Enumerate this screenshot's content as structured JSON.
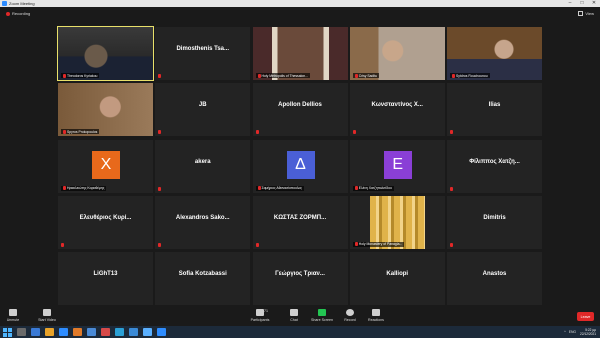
{
  "window": {
    "title": "Zoom Meeting",
    "controls": [
      "–",
      "□",
      "✕"
    ]
  },
  "topbar": {
    "recording_label": "Recording",
    "view_label": "View"
  },
  "tiles": [
    {
      "name": "Theodoros Kyriakou",
      "kind": "video",
      "active": true,
      "muted": true,
      "scene": "man-dark"
    },
    {
      "name": "Dimosthenis Tsa...",
      "kind": "text",
      "muted": true
    },
    {
      "name": "Holy Metropolis of Thessalon...",
      "kind": "video",
      "muted": true,
      "scene": "hall"
    },
    {
      "name": "Crisy Saditu",
      "kind": "video",
      "muted": true,
      "scene": "woman-books"
    },
    {
      "name": "Sytdros Rouchounou",
      "kind": "video",
      "muted": true,
      "scene": "man-books"
    },
    {
      "name": "Spyros Prokopoulos",
      "kind": "video",
      "muted": true,
      "scene": "man-shelves"
    },
    {
      "name": "JB",
      "kind": "text",
      "muted": true
    },
    {
      "name": "Apollon Dellios",
      "kind": "text",
      "muted": true
    },
    {
      "name": "Κωνσταντίνος Χ...",
      "kind": "text",
      "muted": true
    },
    {
      "name": "Ilias",
      "kind": "text",
      "muted": true
    },
    {
      "name": "Ηρακλειώτης Καραθέμης",
      "kind": "avatar",
      "letter": "X",
      "color": "#e8691b",
      "muted": true
    },
    {
      "name": "akera",
      "kind": "text",
      "muted": true
    },
    {
      "name": "Σαμήριος Αθανασίοπουλος",
      "kind": "avatar",
      "letter": "Δ",
      "color": "#4a5fd6",
      "muted": true
    },
    {
      "name": "Ελένη Χατζηπολιτίδου",
      "kind": "avatar",
      "letter": "E",
      "color": "#8a3fd6",
      "muted": true
    },
    {
      "name": "Φίλιππος Χατζη...",
      "kind": "text",
      "muted": true
    },
    {
      "name": "Ελευθέριος Κυρί...",
      "kind": "text",
      "muted": true
    },
    {
      "name": "Alexandros Sako...",
      "kind": "text",
      "muted": true
    },
    {
      "name": "ΚΩΣΤΑΣ ΖΟΡΜΠ...",
      "kind": "text",
      "muted": true
    },
    {
      "name": "Holy Monastery of Panagia...",
      "kind": "video",
      "muted": true,
      "scene": "icon-gold"
    },
    {
      "name": "Dimitris",
      "kind": "text",
      "muted": true
    },
    {
      "name": "LiGhT13",
      "kind": "text",
      "muted": false
    },
    {
      "name": "Sofia Kotzabassi",
      "kind": "text",
      "muted": false
    },
    {
      "name": "Γεώργιος Τριαν...",
      "kind": "text",
      "muted": false
    },
    {
      "name": "Kalliopi",
      "kind": "text",
      "muted": false
    },
    {
      "name": "Anastos",
      "kind": "text",
      "muted": false
    }
  ],
  "toolbar": {
    "left": [
      {
        "label": "Unmute",
        "icon": "microphone-icon"
      },
      {
        "label": "Start Video",
        "icon": "camera-icon"
      }
    ],
    "center": [
      {
        "label": "Participants",
        "icon": "participants-icon",
        "count": "71"
      },
      {
        "label": "Chat",
        "icon": "chat-icon"
      },
      {
        "label": "Share Screen",
        "icon": "share-screen-icon"
      },
      {
        "label": "Record",
        "icon": "record-icon"
      },
      {
        "label": "Reactions",
        "icon": "reactions-icon"
      }
    ],
    "leave_label": "Leave"
  },
  "taskbar": {
    "tray_items": [
      "ENG",
      "^"
    ],
    "time": "5:22 μμ",
    "date": "22/12/2021"
  },
  "colors": {
    "accent": "#2d8cff",
    "share_green": "#23c552",
    "mute_red": "#e02828",
    "active_border": "#e8e06a"
  }
}
